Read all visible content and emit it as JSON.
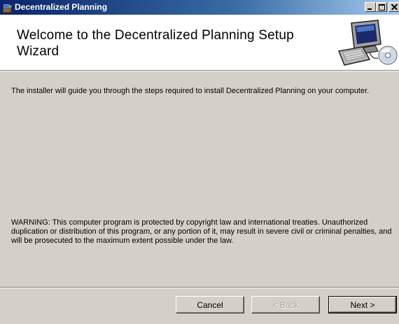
{
  "window": {
    "title": "Decentralized Planning"
  },
  "banner": {
    "title": "Welcome to the Decentralized Planning Setup Wizard",
    "graphic_icon": "computer-setup-icon"
  },
  "body": {
    "intro": "The installer will guide you through the steps required to install Decentralized Planning on your computer.",
    "warning": "WARNING: This computer program is protected by copyright law and international treaties. Unauthorized duplication or distribution of this program, or any portion of it, may result in severe civil or criminal penalties, and will be prosecuted to the maximum extent possible under the law."
  },
  "buttons": {
    "cancel": "Cancel",
    "back": "< Back",
    "next": "Next >"
  },
  "colors": {
    "title_bar_start": "#0a246a",
    "title_bar_end": "#a6caf0",
    "dialog_face": "#d4d0c8",
    "banner_background": "#ffffff"
  }
}
